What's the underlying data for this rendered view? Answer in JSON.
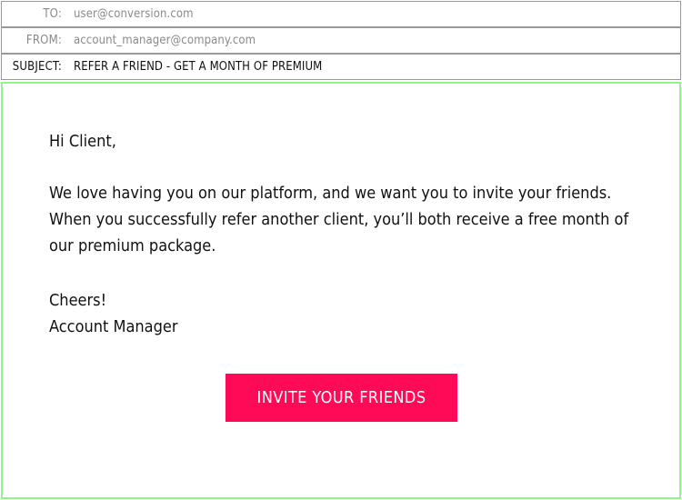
{
  "header": {
    "to": {
      "label": "TO:",
      "value": "user@conversion.com"
    },
    "from": {
      "label": "FROM:",
      "value": "account_manager@company.com"
    },
    "subject": {
      "label": "SUBJECT:",
      "value": "REFER A FRIEND - GET A MONTH OF PREMIUM"
    }
  },
  "body": {
    "greeting": "Hi Client,",
    "message": "We love having you on our platform, and we want you to invite your friends. When you successfully refer another client, you’ll both receive a free month of our premium package.",
    "closing": "Cheers!",
    "signature": "Account Manager",
    "cta_label": "INVITE YOUR FRIENDS"
  },
  "colors": {
    "cta_background": "#ff0a56",
    "body_border": "#8ff58f",
    "header_border": "#9a9a9a"
  }
}
